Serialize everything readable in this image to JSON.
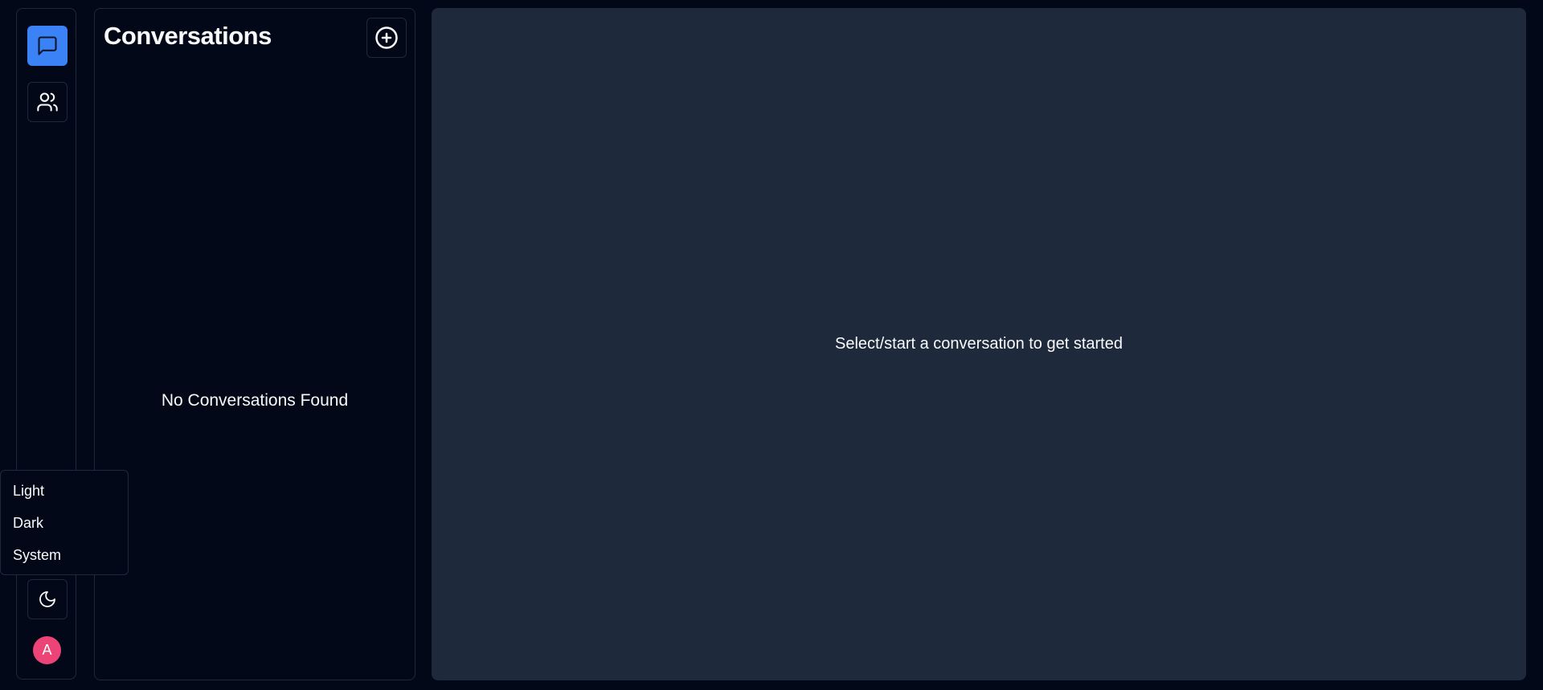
{
  "sidebar": {
    "buttons": [
      {
        "name": "conversations",
        "icon": "message-square-icon",
        "active": true
      },
      {
        "name": "contacts",
        "icon": "users-icon",
        "active": false
      },
      {
        "name": "theme",
        "icon": "moon-icon",
        "active": false
      }
    ],
    "avatar_initial": "A",
    "avatar_color": "#ec4476",
    "accent_color": "#3b82f6"
  },
  "conversations": {
    "title": "Conversations",
    "add_icon": "plus-circle-icon",
    "empty_text": "No Conversations Found"
  },
  "main": {
    "placeholder_text": "Select/start a conversation to get started"
  },
  "theme_menu": {
    "items": [
      {
        "label": "Light"
      },
      {
        "label": "Dark"
      },
      {
        "label": "System"
      }
    ]
  }
}
